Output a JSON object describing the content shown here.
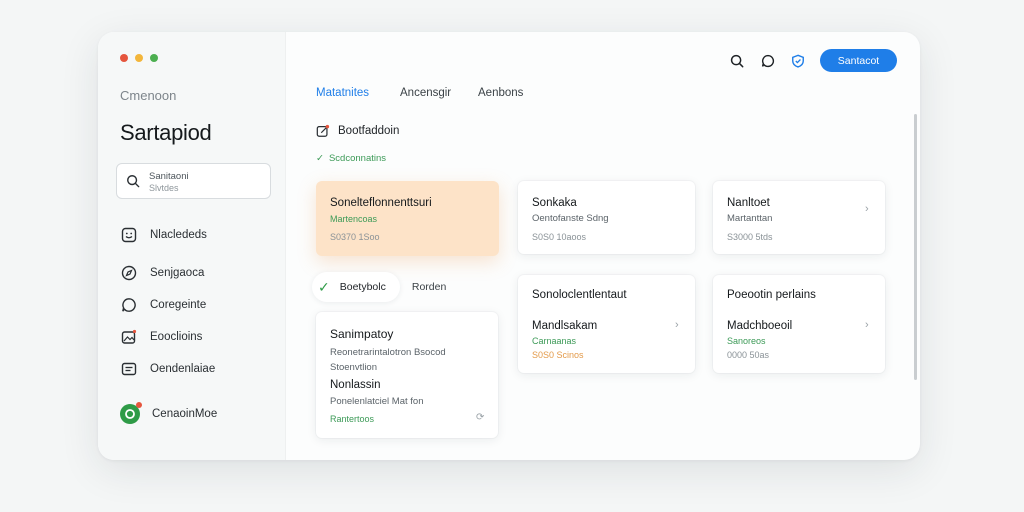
{
  "colors": {
    "accent": "#1f7ee8",
    "green": "#3c9a57",
    "orange": "#e39a4a",
    "highlight": "#fde3c8"
  },
  "window_controls": [
    {
      "name": "close",
      "color": "#e5553d"
    },
    {
      "name": "minimize",
      "color": "#f3b63b"
    },
    {
      "name": "maximize",
      "color": "#4caf50"
    }
  ],
  "sidebar": {
    "subtitle": "Cmenoon",
    "title": "Sartapiod",
    "search": {
      "line1": "Sanitaoni",
      "line2": "Slvtdes"
    },
    "items": [
      {
        "label": "Nlaclededs",
        "icon": "smile-icon"
      },
      {
        "label": "Senjgaoca",
        "icon": "compass-icon"
      },
      {
        "label": "Coregeinte",
        "icon": "chat-icon"
      },
      {
        "label": "Eooclioins",
        "icon": "gallery-icon"
      },
      {
        "label": "Oendenlaiae",
        "icon": "inbox-icon"
      }
    ],
    "profile": {
      "label": "CenaoinMoe",
      "icon": "profile-icon"
    }
  },
  "topbar": {
    "icons": [
      "search-icon",
      "chat-icon",
      "shield-icon"
    ],
    "button_label": "Santacot"
  },
  "tabs": [
    {
      "label": "Matatnites",
      "active": true
    },
    {
      "label": "Ancensgir",
      "active": false
    },
    {
      "label": "Aenbons",
      "active": false
    }
  ],
  "section": {
    "title": "Bootfaddoin",
    "subtitle": "Scdconnatins"
  },
  "cards": [
    {
      "title": "Sonelteflonnenttsuri",
      "line1": "Martencoas",
      "line2": "S0370 1Soo",
      "highlighted": true
    },
    {
      "title": "Sonkaka",
      "line1": "Oentofanste Sdng",
      "line2": "S0S0 10aoos"
    },
    {
      "title": "Nanltoet",
      "line1": "Martanttan",
      "line2": "S3000 5tds"
    },
    {
      "title": "Sonoloclentlentaut",
      "sub_title": "Mandlsakam",
      "line1": "Carnaanas",
      "line2": "S0S0 Scinos"
    },
    {
      "title": "Poeootin perlains",
      "sub_title": "Madchboeoil",
      "line1": "Sanoreos",
      "line2": "0000 50as"
    }
  ],
  "pill_row": {
    "selected_label": "Boetybolc",
    "other_label": "Rorden"
  },
  "detail_card": {
    "title": "Sanimpatoy",
    "line1": "Reonetrarintalotron Bsocod",
    "line2": "Stoenvtlion",
    "title2": "Nonlassin",
    "line3": "Ponelenlatciel Mat fon",
    "footer": "Rantertoos"
  }
}
